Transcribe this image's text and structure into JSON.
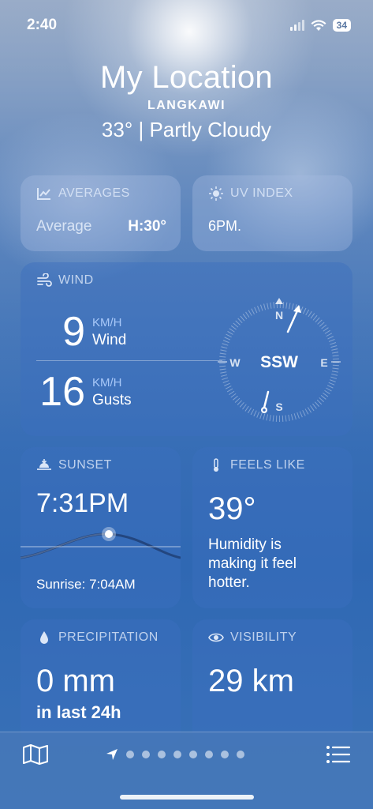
{
  "status": {
    "time": "2:40",
    "battery": "34",
    "icons": [
      "signal-icon",
      "wifi-icon",
      "battery-icon"
    ]
  },
  "header": {
    "title": "My Location",
    "subtitle": "LANGKAWI",
    "summary": "33°  |  Partly Cloudy"
  },
  "averages": {
    "title": "AVERAGES",
    "label": "Average",
    "value": "H:30°"
  },
  "uv": {
    "title": "UV INDEX",
    "value": "6PM."
  },
  "wind": {
    "title": "WIND",
    "speed": "9",
    "speed_unit": "KM/H",
    "speed_label": "Wind",
    "gusts": "16",
    "gusts_unit": "KM/H",
    "gusts_label": "Gusts",
    "direction": "SSW",
    "compass": {
      "n": "N",
      "e": "E",
      "s": "S",
      "w": "W"
    }
  },
  "sunset": {
    "title": "SUNSET",
    "time": "7:31PM",
    "sunrise": "Sunrise: 7:04AM"
  },
  "feels_like": {
    "title": "FEELS LIKE",
    "value": "39°",
    "description": "Humidity is making it feel hotter."
  },
  "precipitation": {
    "title": "PRECIPITATION",
    "value": "0 mm",
    "period": "in last 24h"
  },
  "visibility": {
    "title": "VISIBILITY",
    "value": "29 km"
  },
  "bottom_bar": {
    "icons": [
      "map-icon",
      "location-arrow-icon",
      "list-icon"
    ],
    "page_dots": 8
  },
  "colors": {
    "card": "#3c6ebe",
    "accent_unit": "#b4d2ff"
  }
}
